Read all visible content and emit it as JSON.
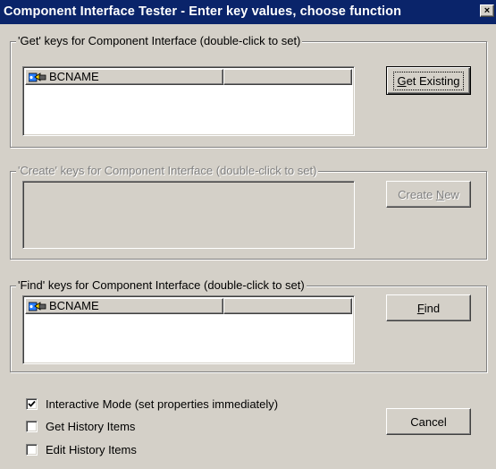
{
  "window": {
    "title": "Component Interface Tester - Enter key values, choose function",
    "close_label": "×"
  },
  "get_group": {
    "legend": "'Get' keys for Component Interface (double-click to set)",
    "columns": [
      "BCNAME",
      ""
    ],
    "button_prefix": "",
    "button_accel": "G",
    "button_rest": "et Existing"
  },
  "create_group": {
    "legend": "'Create' keys for Component Interface (double-click to set)",
    "button_prefix": "Create ",
    "button_accel": "N",
    "button_rest": "ew"
  },
  "find_group": {
    "legend": "'Find' keys for Component Interface (double-click to set)",
    "columns": [
      "BCNAME",
      ""
    ],
    "button_prefix": "",
    "button_accel": "F",
    "button_rest": "ind"
  },
  "options": [
    {
      "label": "Interactive Mode (set properties immediately)",
      "checked": true
    },
    {
      "label": "Get History Items",
      "checked": false
    },
    {
      "label": "Edit History Items",
      "checked": false
    }
  ],
  "cancel_label": "Cancel",
  "icons": {
    "column_key": "key-icon",
    "close": "close-icon",
    "check": "checkmark-icon"
  }
}
